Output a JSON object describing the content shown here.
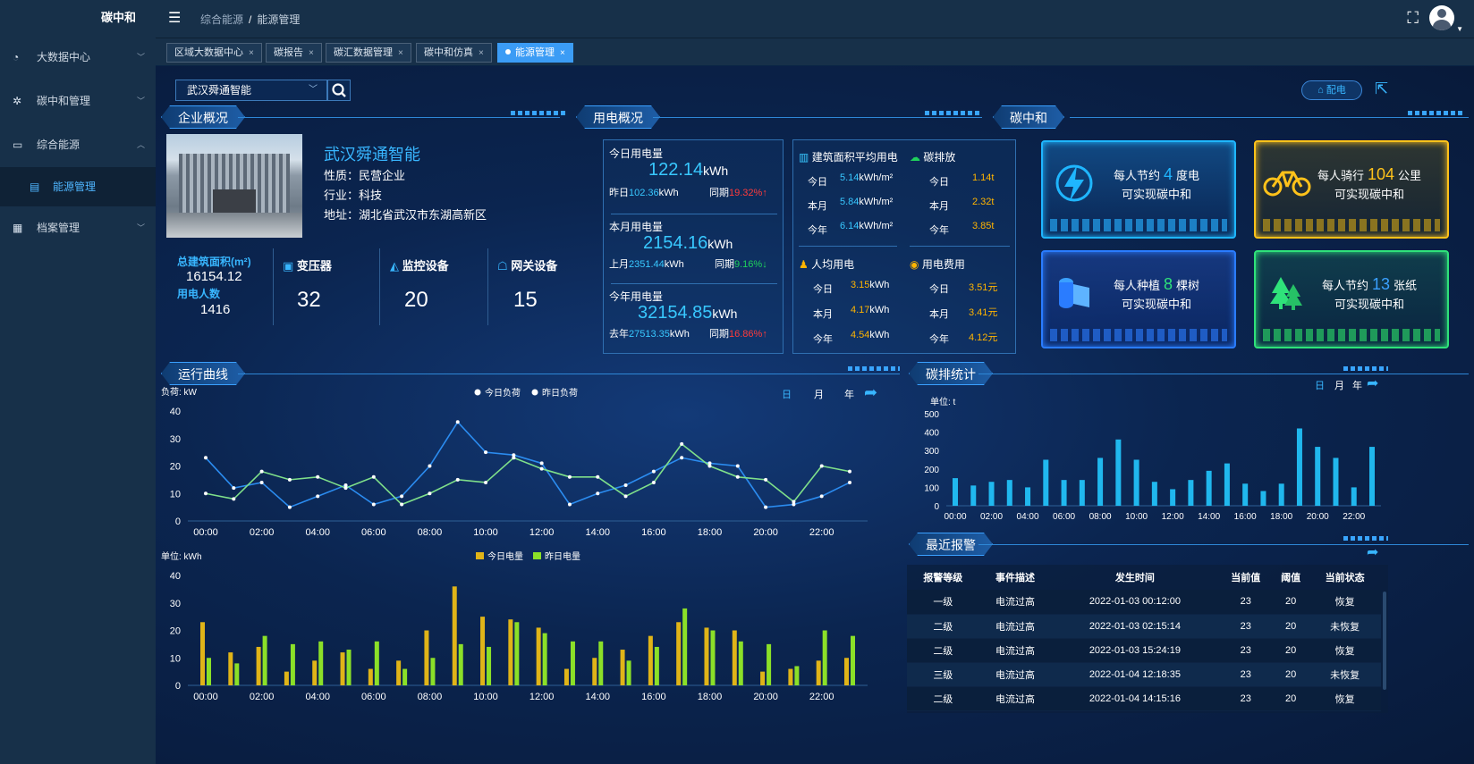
{
  "app": {
    "logo": "碳中和"
  },
  "sidebar": {
    "items": [
      {
        "label": "大数据中心",
        "icon": "dashboard-icon"
      },
      {
        "label": "碳中和管理",
        "icon": "settings-icon"
      },
      {
        "label": "综合能源",
        "icon": "monitor-icon",
        "expanded": true
      },
      {
        "label": "能源管理",
        "icon": "document-icon",
        "sub": true,
        "active": true
      },
      {
        "label": "档案管理",
        "icon": "grid-icon"
      }
    ]
  },
  "breadcrumb": {
    "parent": "综合能源",
    "sep": "/",
    "current": "能源管理"
  },
  "tabs": [
    {
      "label": "区域大数据中心"
    },
    {
      "label": "碳报告"
    },
    {
      "label": "碳汇数据管理"
    },
    {
      "label": "碳中和仿真"
    },
    {
      "label": "能源管理",
      "active": true
    }
  ],
  "search": {
    "value": "武汉舜通智能"
  },
  "top_right": {
    "power_label": "配电"
  },
  "company": {
    "title": "企业概况",
    "name": "武汉舜通智能",
    "nature_label": "性质：",
    "nature": "民营企业",
    "industry_label": "行业：",
    "industry": "科技",
    "address_label": "地址：",
    "address": "湖北省武汉市东湖高新区",
    "area_label": "总建筑面积(m²)",
    "area": "16154.12",
    "users_label": "用电人数",
    "users": "1416",
    "transformer_label": "变压器",
    "transformer": "32",
    "monitor_label": "监控设备",
    "monitor": "20",
    "gateway_label": "网关设备",
    "gateway": "15"
  },
  "usage": {
    "title": "用电概况",
    "today_label": "今日用电量",
    "today": "122.14",
    "today_unit": "kWh",
    "yesterday_label": "昨日",
    "yesterday": "102.36",
    "yesterday_unit": "kWh",
    "yoy_label": "同期",
    "today_yoy": "19.32%",
    "month_label": "本月用电量",
    "month": "2154.16",
    "month_unit": "kWh",
    "lastmonth_label": "上月",
    "lastmonth": "2351.44",
    "lastmonth_unit": "kWh",
    "month_yoy": "9.16%",
    "year_label": "今年用电量",
    "year": "32154.85",
    "year_unit": "kWh",
    "lastyear_label": "去年",
    "lastyear": "27513.35",
    "lastyear_unit": "kWh",
    "year_yoy": "16.86%",
    "area_title": "建筑面积平均用电",
    "area_rows": [
      {
        "k": "今日",
        "v": "5.14",
        "u": "kWh/m²"
      },
      {
        "k": "本月",
        "v": "5.84",
        "u": "kWh/m²"
      },
      {
        "k": "今年",
        "v": "6.14",
        "u": "kWh/m²"
      }
    ],
    "carbon_title": "碳排放",
    "carbon_rows": [
      {
        "k": "今日",
        "v": "1.14t"
      },
      {
        "k": "本月",
        "v": "2.32t"
      },
      {
        "k": "今年",
        "v": "3.85t"
      }
    ],
    "person_title": "人均用电",
    "person_rows": [
      {
        "k": "今日",
        "v": "3.15",
        "u": "kWh"
      },
      {
        "k": "本月",
        "v": "4.17",
        "u": "kWh"
      },
      {
        "k": "今年",
        "v": "4.54",
        "u": "kWh"
      }
    ],
    "cost_title": "用电费用",
    "cost_rows": [
      {
        "k": "今日",
        "v": "3.51元"
      },
      {
        "k": "本月",
        "v": "3.41元"
      },
      {
        "k": "今年",
        "v": "4.12元"
      }
    ]
  },
  "carbon_neutral": {
    "title": "碳中和",
    "cards": [
      {
        "pre": "每人节约",
        "num": "4",
        "post": "度电",
        "line2": "可实现碳中和",
        "color": "#1fb6ff",
        "icon": "lightning-icon"
      },
      {
        "pre": "每人骑行",
        "num": "104",
        "post": "公里",
        "line2": "可实现碳中和",
        "color": "#ffc21a",
        "icon": "bicycle-icon"
      },
      {
        "pre": "每人种植",
        "num": "8",
        "post": "棵树",
        "line2": "可实现碳中和",
        "color": "#2a7cff",
        "icon": "paper-roll-icon"
      },
      {
        "pre": "每人节约",
        "num": "13",
        "post": "张纸",
        "line2": "可实现碳中和",
        "color": "#2fe27a",
        "icon": "tree-icon"
      }
    ]
  },
  "run_curve": {
    "title": "运行曲线",
    "period_day": "日",
    "period_month": "月",
    "period_year": "年"
  },
  "carbon_stats": {
    "title": "碳排统计",
    "unit": "单位: t",
    "period_day": "日",
    "period_month": "月",
    "period_year": "年"
  },
  "alarms": {
    "title": "最近报警",
    "headers": [
      "报警等级",
      "事件描述",
      "发生时间",
      "当前值",
      "阈值",
      "当前状态"
    ],
    "rows": [
      {
        "level": "一级",
        "desc": "电流过高",
        "time": "2022-01-03 00:12:00",
        "cur": "23",
        "th": "20",
        "status": "恢复"
      },
      {
        "level": "二级",
        "desc": "电流过高",
        "time": "2022-01-03 02:15:14",
        "cur": "23",
        "th": "20",
        "status": "未恢复"
      },
      {
        "level": "二级",
        "desc": "电流过高",
        "time": "2022-01-03 15:24:19",
        "cur": "23",
        "th": "20",
        "status": "恢复"
      },
      {
        "level": "三级",
        "desc": "电流过高",
        "time": "2022-01-04 12:18:35",
        "cur": "23",
        "th": "20",
        "status": "未恢复"
      },
      {
        "level": "二级",
        "desc": "电流过高",
        "time": "2022-01-04 14:15:16",
        "cur": "23",
        "th": "20",
        "status": "恢复"
      }
    ]
  },
  "chart_data": [
    {
      "type": "line",
      "id": "load",
      "ylabel": "负荷: kW",
      "ylim": [
        0,
        40
      ],
      "yticks": [
        0,
        10,
        20,
        30,
        40
      ],
      "xticks": [
        "00:00",
        "02:00",
        "04:00",
        "06:00",
        "08:00",
        "10:00",
        "12:00",
        "14:00",
        "16:00",
        "18:00",
        "20:00",
        "22:00"
      ],
      "series": [
        {
          "name": "今日负荷",
          "color": "#2b8cf0",
          "values": [
            23,
            12,
            14,
            5,
            9,
            13,
            6,
            9,
            20,
            36,
            25,
            24,
            21,
            6,
            10,
            13,
            18,
            23,
            21,
            20,
            5,
            6,
            9,
            14
          ]
        },
        {
          "name": "昨日负荷",
          "color": "#7fe08a",
          "values": [
            10,
            8,
            18,
            15,
            16,
            12,
            16,
            6,
            10,
            15,
            14,
            23,
            19,
            16,
            16,
            9,
            14,
            28,
            20,
            16,
            15,
            7,
            20,
            18
          ]
        }
      ]
    },
    {
      "type": "bar",
      "id": "energy",
      "ylabel": "单位: kWh",
      "ylim": [
        0,
        40
      ],
      "yticks": [
        0,
        10,
        20,
        30,
        40
      ],
      "xticks": [
        "00:00",
        "02:00",
        "04:00",
        "06:00",
        "08:00",
        "10:00",
        "12:00",
        "14:00",
        "16:00",
        "18:00",
        "20:00",
        "22:00"
      ],
      "series": [
        {
          "name": "今日电量",
          "color": "#e0b418",
          "values": [
            23,
            12,
            14,
            5,
            9,
            12,
            6,
            9,
            20,
            36,
            25,
            24,
            21,
            6,
            10,
            13,
            18,
            23,
            21,
            20,
            5,
            6,
            9,
            10
          ]
        },
        {
          "name": "昨日电量",
          "color": "#8be028",
          "values": [
            10,
            8,
            18,
            15,
            16,
            13,
            16,
            6,
            10,
            15,
            14,
            23,
            19,
            16,
            16,
            9,
            14,
            28,
            20,
            16,
            15,
            7,
            20,
            18
          ]
        }
      ]
    },
    {
      "type": "bar",
      "id": "carbon",
      "ylabel": "单位: t",
      "ylim": [
        0,
        500
      ],
      "yticks": [
        0,
        100,
        200,
        300,
        400,
        500
      ],
      "xticks": [
        "00:00",
        "02:00",
        "04:00",
        "06:00",
        "08:00",
        "10:00",
        "12:00",
        "14:00",
        "16:00",
        "18:00",
        "20:00",
        "22:00"
      ],
      "series": [
        {
          "name": "碳排",
          "color": "#22c8ff",
          "values": [
            150,
            110,
            130,
            140,
            100,
            250,
            140,
            140,
            260,
            360,
            250,
            130,
            90,
            140,
            190,
            230,
            120,
            80,
            120,
            420,
            320,
            260,
            100,
            320
          ]
        }
      ]
    }
  ]
}
